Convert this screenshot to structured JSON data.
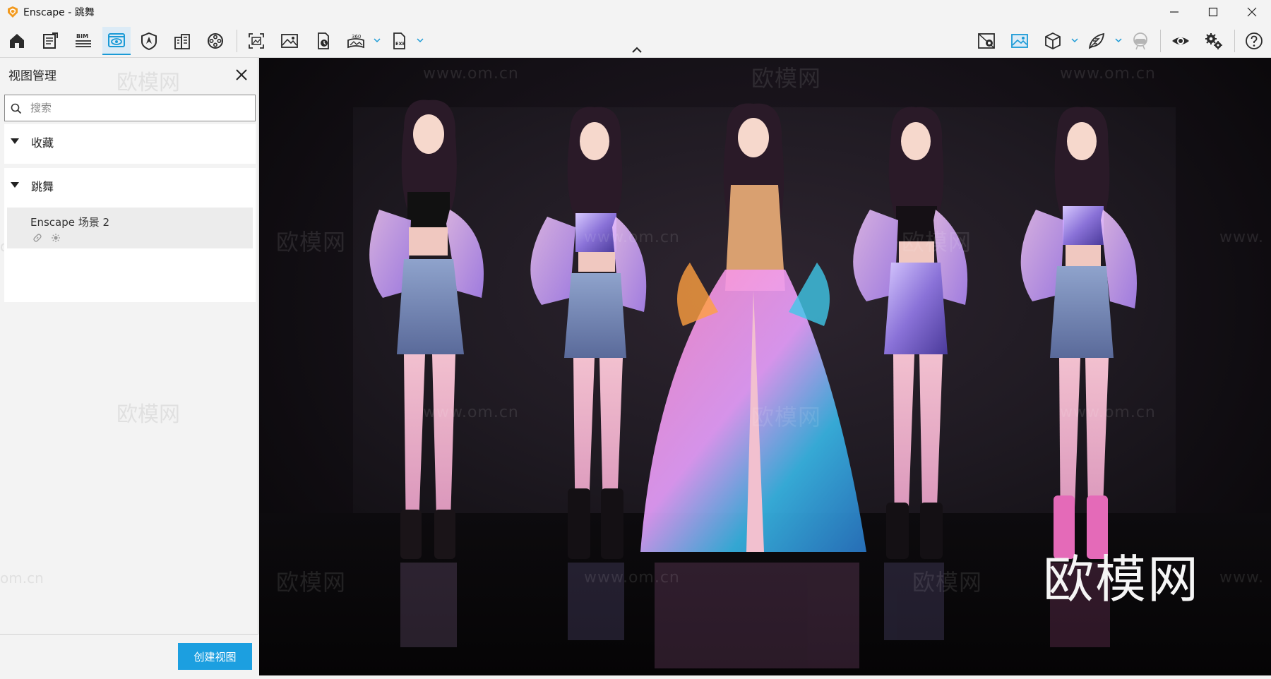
{
  "window": {
    "title": "Enscape - 跳舞"
  },
  "colors": {
    "accent": "#1c9fe0",
    "logo_orange": "#f29a1f",
    "active_tab_bg": "#dcebf6"
  },
  "toolbar": {
    "left_icons": [
      "home-icon",
      "document-settings-icon",
      "bim-icon",
      "view-management-icon",
      "shield-map-icon",
      "building-icon",
      "film-reel-icon",
      "screenshot-icon",
      "image-icon",
      "batch-render-icon",
      "panorama-360-icon",
      "export-exe-icon"
    ],
    "bim_label": "BIM",
    "pano_label": "360",
    "exe_label": "EXE",
    "right_icons": [
      "map-pin-icon",
      "gallery-icon",
      "cube-icon",
      "material-leaf-icon",
      "vr-headset-icon",
      "eye-icon",
      "settings-icon",
      "help-icon"
    ]
  },
  "panel": {
    "title": "视图管理",
    "search_placeholder": "搜索",
    "sections": [
      {
        "label": "收藏"
      },
      {
        "label": "跳舞",
        "items": [
          {
            "name": "Enscape 场景 2"
          }
        ]
      }
    ],
    "create_button": "创建视图"
  },
  "viewport": {
    "brand_mark": "欧模网",
    "watermark_url": "www.om.cn",
    "watermark_cn": "欧模网",
    "watermark_partial_url": "om.cn",
    "watermark_edge_url": "www.",
    "scene": "five dancers posing on a dark reflective stage"
  }
}
